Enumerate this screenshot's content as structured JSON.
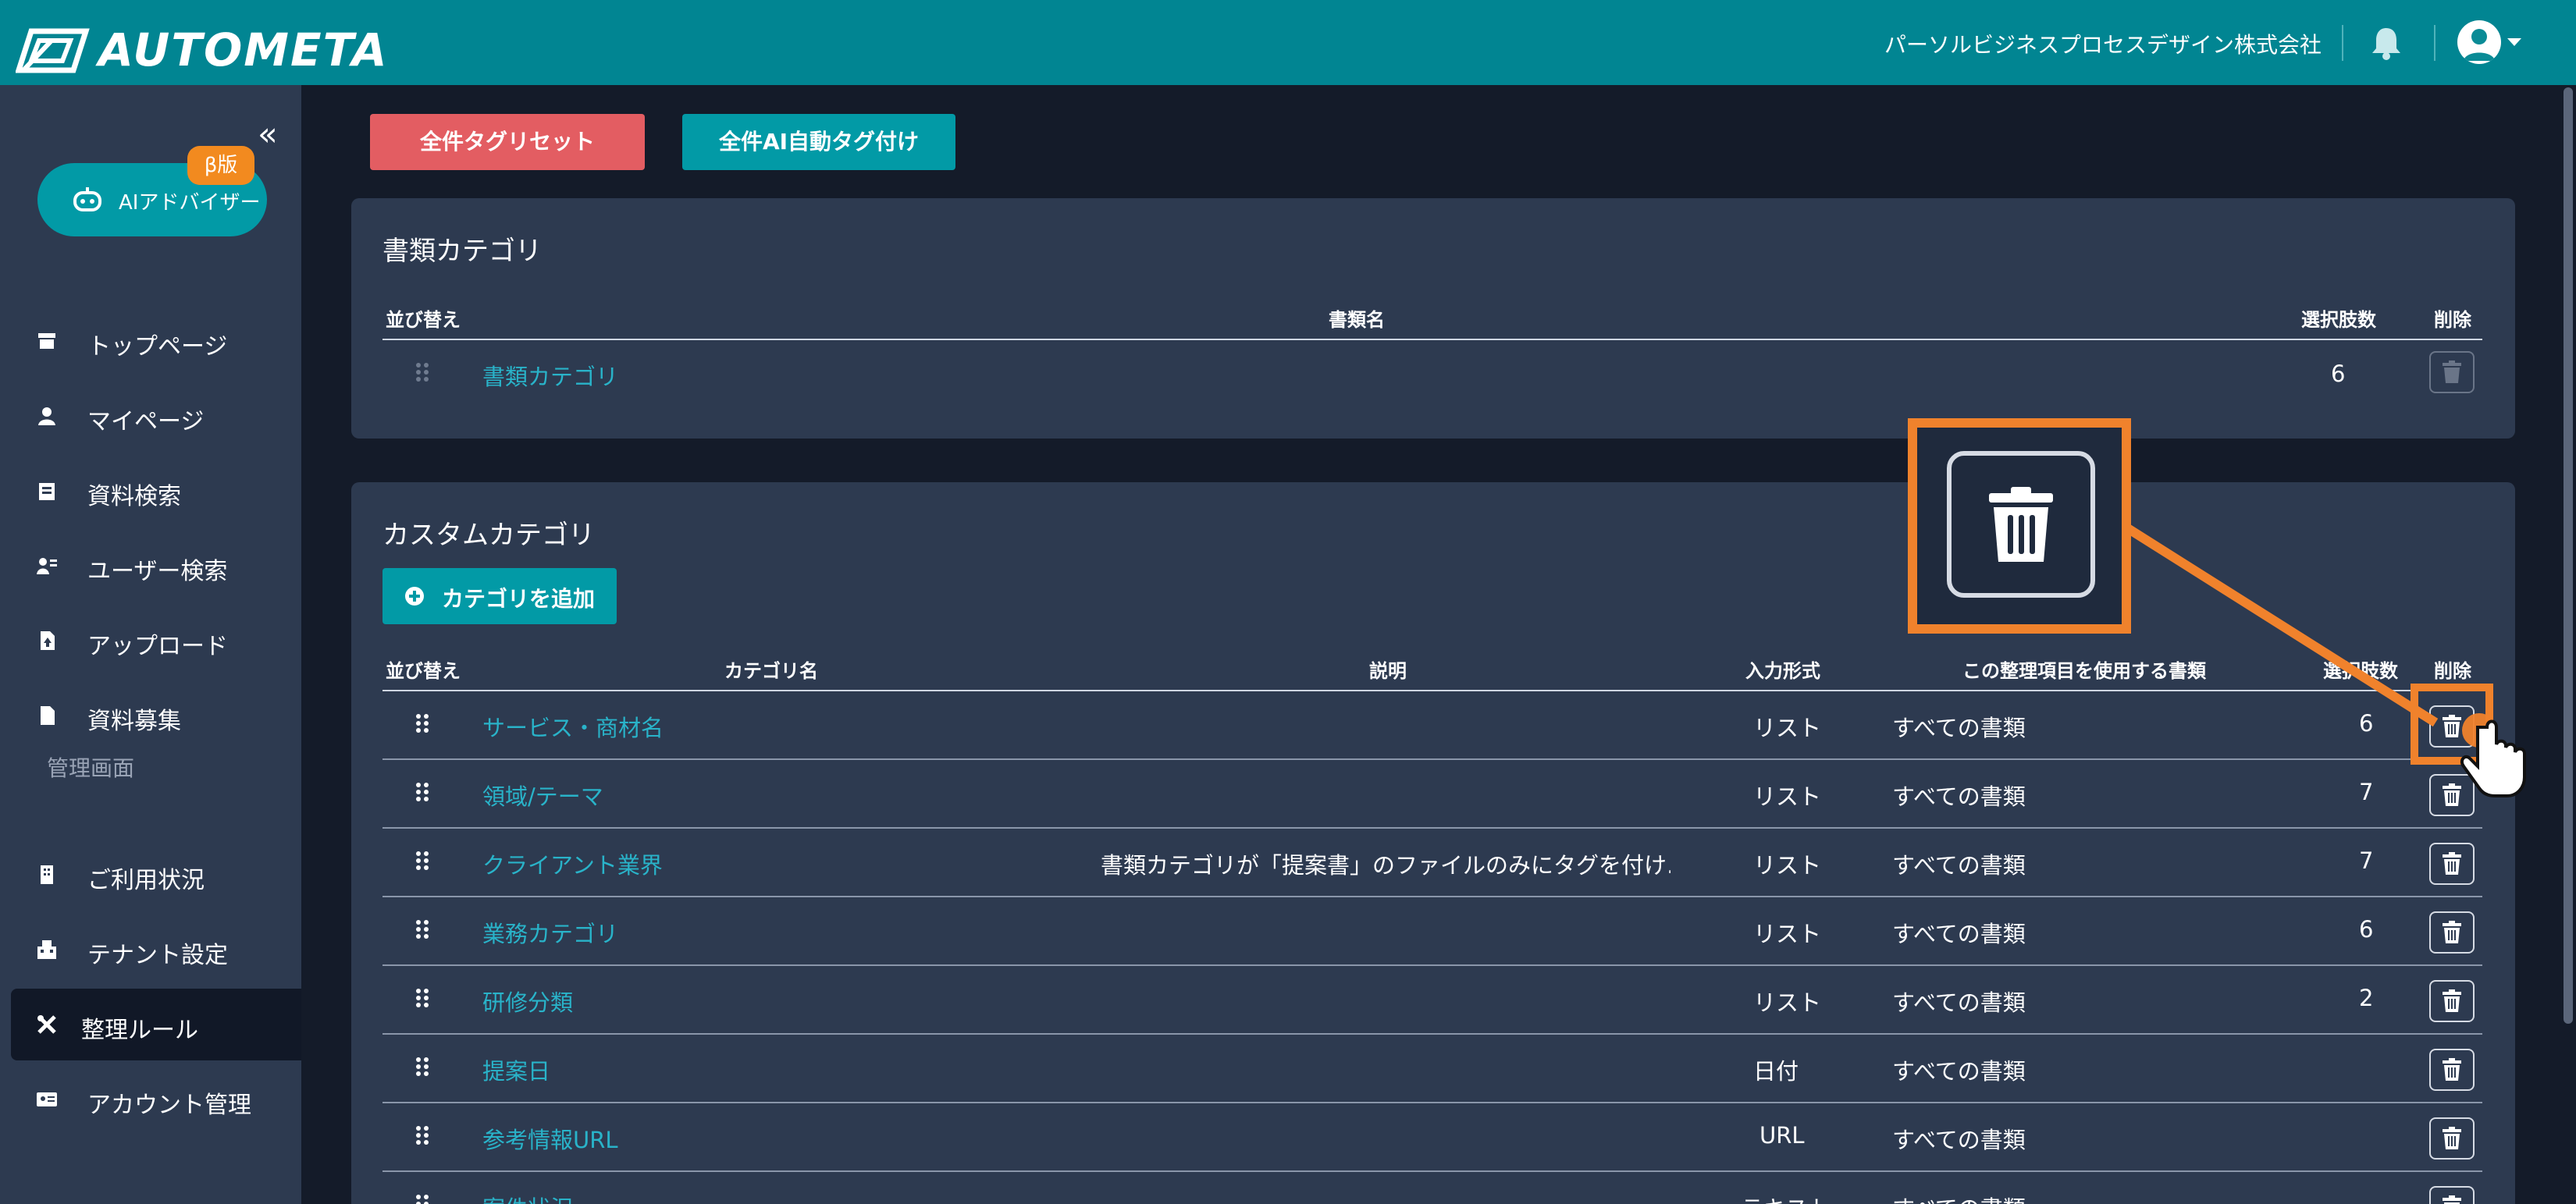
{
  "header": {
    "logo_text": "AUTOMETA",
    "company": "パーソルビジネスプロセスデザイン株式会社",
    "bell_icon": "bell-icon",
    "avatar_icon": "user-avatar-icon"
  },
  "sidebar": {
    "collapse_label": "«",
    "ai_button": "AIアドバイザー",
    "beta_badge": "β版",
    "items": [
      {
        "label": "トップページ",
        "icon": "store-icon"
      },
      {
        "label": "マイページ",
        "icon": "person-icon"
      },
      {
        "label": "資料検索",
        "icon": "document-search-icon"
      },
      {
        "label": "ユーザー検索",
        "icon": "user-search-icon"
      },
      {
        "label": "アップロード",
        "icon": "upload-icon"
      },
      {
        "label": "資料募集",
        "icon": "file-icon"
      }
    ],
    "admin_section": "管理画面",
    "admin_items": [
      {
        "label": "ご利用状況",
        "icon": "building-icon"
      },
      {
        "label": "テナント設定",
        "icon": "tenant-icon"
      },
      {
        "label": "整理ルール",
        "icon": "tools-icon"
      },
      {
        "label": "アカウント管理",
        "icon": "id-card-icon"
      }
    ]
  },
  "actions": {
    "reset_all": "全件タグリセット",
    "ai_tag_all": "全件AI自動タグ付け"
  },
  "doc_category": {
    "title": "書類カテゴリ",
    "headers": {
      "sort": "並び替え",
      "name": "書類名",
      "choices": "選択肢数",
      "delete": "削除"
    },
    "rows": [
      {
        "name": "書類カテゴリ",
        "choices": "6"
      }
    ]
  },
  "custom_category": {
    "title": "カスタムカテゴリ",
    "add_button": "カテゴリを追加",
    "headers": {
      "sort": "並び替え",
      "name": "カテゴリ名",
      "desc": "説明",
      "input": "入力形式",
      "docs": "この整理項目を使用する書類",
      "choices": "選択肢数",
      "delete": "削除"
    },
    "rows": [
      {
        "name": "サービス・商材名",
        "desc": "",
        "input": "リスト",
        "docs": "すべての書類",
        "choices": "6"
      },
      {
        "name": "領域/テーマ",
        "desc": "",
        "input": "リスト",
        "docs": "すべての書類",
        "choices": "7"
      },
      {
        "name": "クライアント業界",
        "desc": "書類カテゴリが「提案書」のファイルのみにタグを付け…",
        "input": "リスト",
        "docs": "すべての書類",
        "choices": "7"
      },
      {
        "name": "業務カテゴリ",
        "desc": "",
        "input": "リスト",
        "docs": "すべての書類",
        "choices": "6"
      },
      {
        "name": "研修分類",
        "desc": "",
        "input": "リスト",
        "docs": "すべての書類",
        "choices": "2"
      },
      {
        "name": "提案日",
        "desc": "",
        "input": "日付",
        "docs": "すべての書類",
        "choices": ""
      },
      {
        "name": "参考情報URL",
        "desc": "",
        "input": "URL",
        "docs": "すべての書類",
        "choices": ""
      },
      {
        "name": "案件状況",
        "desc": "",
        "input": "テキスト",
        "docs": "すべての書類",
        "choices": ""
      }
    ]
  },
  "colors": {
    "header": "#018592",
    "sidebar": "#2d3a50",
    "accent": "#029aa6",
    "danger": "#e35d62",
    "callout": "#f0822c",
    "link": "#29b3c9"
  }
}
